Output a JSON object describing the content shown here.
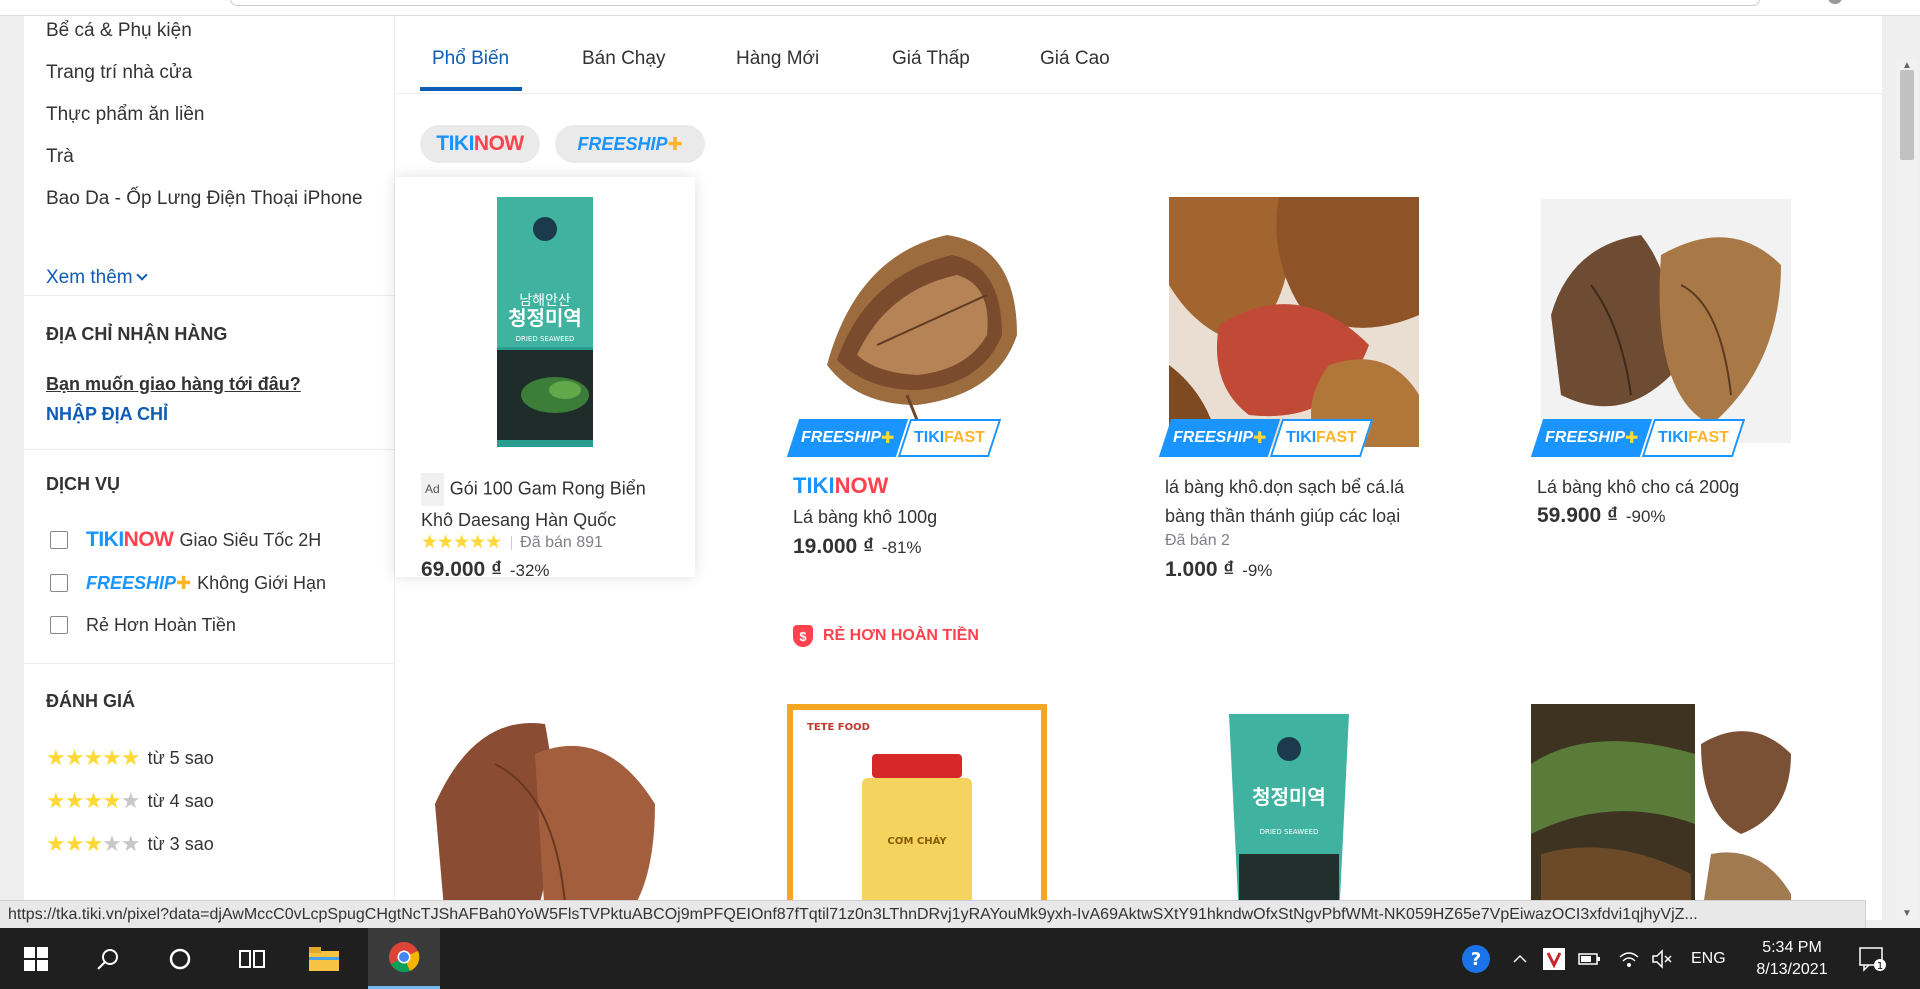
{
  "browser": {
    "status_url": "https://tka.tiki.vn/pixel?data=djAwMccC0vLcpSpugCHgtNcTJShAFBah0YoW5FlsTVPktuABCOj9mPFQEIOnf87fTqtil71z0n3LThnDRvj1yRAYouMk9yxh-IvA69AktwSXtY91hkndwOfxStNgvPbfWMt-NK059HZ65e7VpEiwazOCI3xfdvi1qjhyVjZ..."
  },
  "sidebar": {
    "categories": [
      "Bể cá & Phụ kiện",
      "Trang trí nhà cửa",
      "Thực phẩm ăn liền",
      "Trà",
      "Bao Da - Ốp Lưng Điện Thoại iPhone"
    ],
    "see_more": "Xem thêm",
    "address": {
      "title": "ĐỊA CHỈ NHẬN HÀNG",
      "question": "Bạn muốn giao hàng tới đâu?",
      "link": "NHẬP ĐỊA CHỈ"
    },
    "services": {
      "title": "DỊCH VỤ",
      "items": [
        {
          "brand_a": "TIKI",
          "brand_b": "NOW",
          "label": "Giao Siêu Tốc 2H"
        },
        {
          "brand": "FREESHIP",
          "plus": "✚",
          "label": "Không Giới Hạn"
        },
        {
          "label": "Rẻ Hơn Hoàn Tiền"
        }
      ]
    },
    "rating": {
      "title": "ĐÁNH GIÁ",
      "items": [
        {
          "stars": 5,
          "label": "từ 5 sao"
        },
        {
          "stars": 4,
          "label": "từ 4 sao"
        },
        {
          "stars": 3,
          "label": "từ 3 sao"
        }
      ]
    }
  },
  "tabs": [
    "Phổ Biến",
    "Bán Chạy",
    "Hàng Mới",
    "Giá Thấp",
    "Giá Cao"
  ],
  "filters": {
    "tikinow_a": "TIKI",
    "tikinow_b": "NOW",
    "freeship": "FREESHIP",
    "freeship_plus": "✚"
  },
  "badge": {
    "freeship": "FREESHIP",
    "plus": "✚",
    "tiki": "TIKI",
    "fast": "FAST"
  },
  "products": [
    {
      "ad": "Ad",
      "name": "Gói 100 Gam Rong Biển Khô Daesang Hàn Quốc",
      "rating": 5,
      "sold": "Đã bán 891",
      "price": "69.000 ₫",
      "discount": "-32%"
    },
    {
      "tikinow_a": "TIKI",
      "tikinow_b": "NOW",
      "name": "Lá bàng khô 100g",
      "price": "19.000 ₫",
      "discount": "-81%",
      "cashback": "RẺ HƠN HOÀN TIỀN",
      "cashback_icon": "$"
    },
    {
      "name": "lá bàng khô.dọn sạch bể cá.lá bàng thần thánh giúp các loại thủy sinh...",
      "sold": "Đã bán 2",
      "price": "1.000 ₫",
      "discount": "-9%"
    },
    {
      "name": "Lá bàng khô cho cá 200g",
      "price": "59.900 ₫",
      "discount": "-90%"
    }
  ],
  "row2_labels": {
    "brand": "TETE FOOD",
    "jar": "CƠM CHÁY",
    "pack_ko": "청정미역",
    "pack_en": "DRIED SEAWEED"
  },
  "seaweed_pack": {
    "ko_top": "남해안산",
    "ko_main": "청정미역",
    "en": "DRIED SEAWEED"
  },
  "taskbar": {
    "lang": "ENG",
    "time": "5:34 PM",
    "date": "8/13/2021",
    "notif_count": "1"
  },
  "colors": {
    "accent": "#0d5cb6",
    "tiki_blue": "#1a94ff",
    "tiki_red": "#ff424e",
    "star": "#fdd836"
  }
}
